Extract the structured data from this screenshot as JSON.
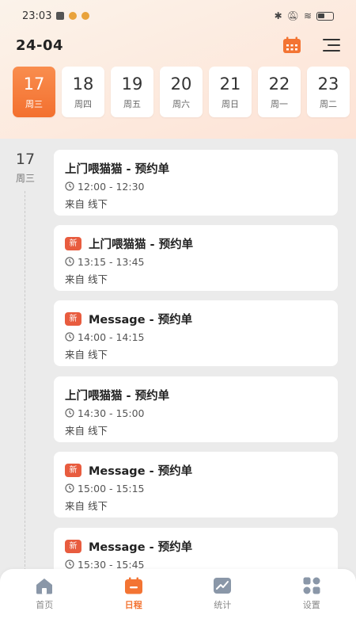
{
  "status_bar": {
    "time": "23:03"
  },
  "header": {
    "title": "24-04"
  },
  "date_strip": [
    {
      "day": "17",
      "weekday": "周三",
      "active": true
    },
    {
      "day": "18",
      "weekday": "周四"
    },
    {
      "day": "19",
      "weekday": "周五"
    },
    {
      "day": "20",
      "weekday": "周六"
    },
    {
      "day": "21",
      "weekday": "周日"
    },
    {
      "day": "22",
      "weekday": "周一"
    },
    {
      "day": "23",
      "weekday": "周二"
    }
  ],
  "timeline": {
    "day": "17",
    "weekday": "周三"
  },
  "appointments": [
    {
      "badge": "",
      "title": "上门喂猫猫 - 预约单",
      "time": "12:00 - 12:30",
      "source": "来自 线下"
    },
    {
      "badge": "新",
      "title": "上门喂猫猫 - 预约单",
      "time": "13:15 - 13:45",
      "source": "来自 线下"
    },
    {
      "badge": "新",
      "title": "Message - 预约单",
      "time": "14:00 - 14:15",
      "source": "来自 线下"
    },
    {
      "badge": "",
      "title": "上门喂猫猫 - 预约单",
      "time": "14:30 - 15:00",
      "source": "来自 线下"
    },
    {
      "badge": "新",
      "title": "Message - 预约单",
      "time": "15:00 - 15:15",
      "source": "来自 线下"
    },
    {
      "badge": "新",
      "title": "Message - 预约单",
      "time": "15:30 - 15:45",
      "source": ""
    }
  ],
  "tabs": [
    {
      "label": "首页",
      "icon": "home-icon"
    },
    {
      "label": "日程",
      "icon": "calendar-icon",
      "active": true
    },
    {
      "label": "统计",
      "icon": "stats-icon"
    },
    {
      "label": "设置",
      "icon": "settings-icon"
    }
  ],
  "colors": {
    "accent": "#f37433",
    "badge": "#e85c3f",
    "inactive_icon": "#8a97a8"
  }
}
